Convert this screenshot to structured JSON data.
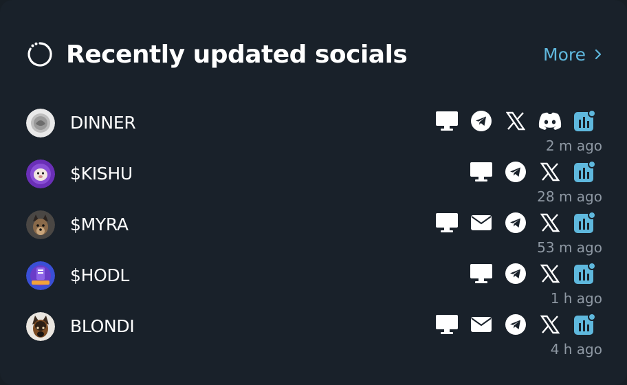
{
  "header": {
    "title": "Recently updated socials",
    "more_label": "More"
  },
  "colors": {
    "background": "#19212a",
    "accent": "#5fb8dd",
    "muted": "#8e98a3",
    "text": "#ffffff"
  },
  "rows": [
    {
      "name": "DINNER",
      "time": "2 m ago",
      "icons": [
        "website-icon",
        "telegram-icon",
        "x-icon",
        "discord-icon",
        "dextools-icon"
      ]
    },
    {
      "name": "$KISHU",
      "time": "28 m ago",
      "icons": [
        "website-icon",
        "telegram-icon",
        "x-icon",
        "dextools-icon"
      ]
    },
    {
      "name": "$MYRA",
      "time": "53 m ago",
      "icons": [
        "website-icon",
        "email-icon",
        "telegram-icon",
        "x-icon",
        "dextools-icon"
      ]
    },
    {
      "name": "$HODL",
      "time": "1 h ago",
      "icons": [
        "website-icon",
        "telegram-icon",
        "x-icon",
        "dextools-icon"
      ]
    },
    {
      "name": "BLONDI",
      "time": "4 h ago",
      "icons": [
        "website-icon",
        "email-icon",
        "telegram-icon",
        "x-icon",
        "dextools-icon"
      ]
    }
  ]
}
